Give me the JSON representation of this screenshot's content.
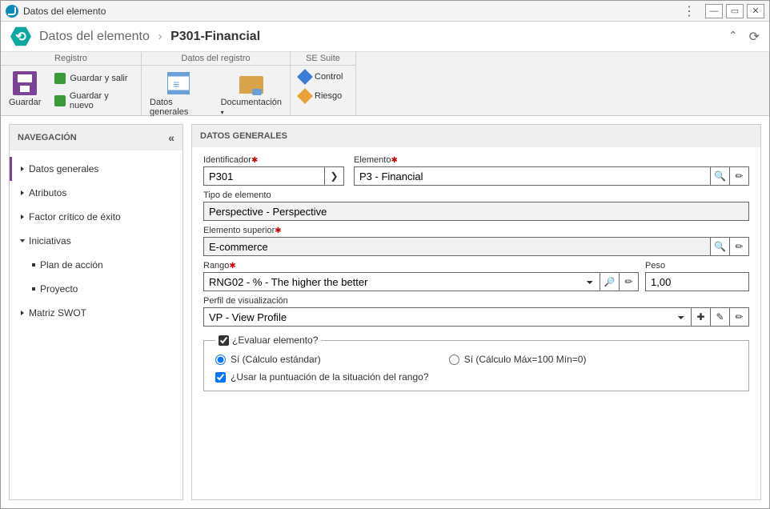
{
  "titlebar": {
    "title": "Datos del elemento"
  },
  "breadcrumb": {
    "root": "Datos del elemento",
    "current": "P301-Financial"
  },
  "ribbon": {
    "group_registro": "Registro",
    "guardar": "Guardar",
    "guardar_salir": "Guardar y salir",
    "guardar_nuevo": "Guardar y nuevo",
    "group_datos_reg": "Datos del registro",
    "datos_generales": "Datos generales",
    "documentacion": "Documentación",
    "group_se": "SE Suite",
    "control": "Control",
    "riesgo": "Riesgo"
  },
  "sidebar": {
    "title": "NAVEGACIÓN",
    "items": {
      "datos_generales": "Datos generales",
      "atributos": "Atributos",
      "factor": "Factor crítico de éxito",
      "iniciativas": "Iniciativas",
      "plan": "Plan de acción",
      "proyecto": "Proyecto",
      "swot": "Matriz SWOT"
    }
  },
  "main": {
    "title": "DATOS GENERALES",
    "identificador_label": "Identificador",
    "identificador_value": "P301",
    "elemento_label": "Elemento",
    "elemento_value": "P3 - Financial",
    "tipo_label": "Tipo de elemento",
    "tipo_value": "Perspective - Perspective",
    "superior_label": "Elemento superior",
    "superior_value": "E-commerce",
    "rango_label": "Rango",
    "rango_value": "RNG02 - % - The higher the better",
    "peso_label": "Peso",
    "peso_value": "1,00",
    "perfil_label": "Perfil de visualización",
    "perfil_value": "VP - View Profile",
    "eval_legend": "¿Evaluar elemento?",
    "radio_std": "Sí (Cálculo estándar)",
    "radio_max": "Sí (Cálculo Máx=100 Mín=0)",
    "check_rango": "¿Usar la puntuación de la situación del rango?"
  }
}
